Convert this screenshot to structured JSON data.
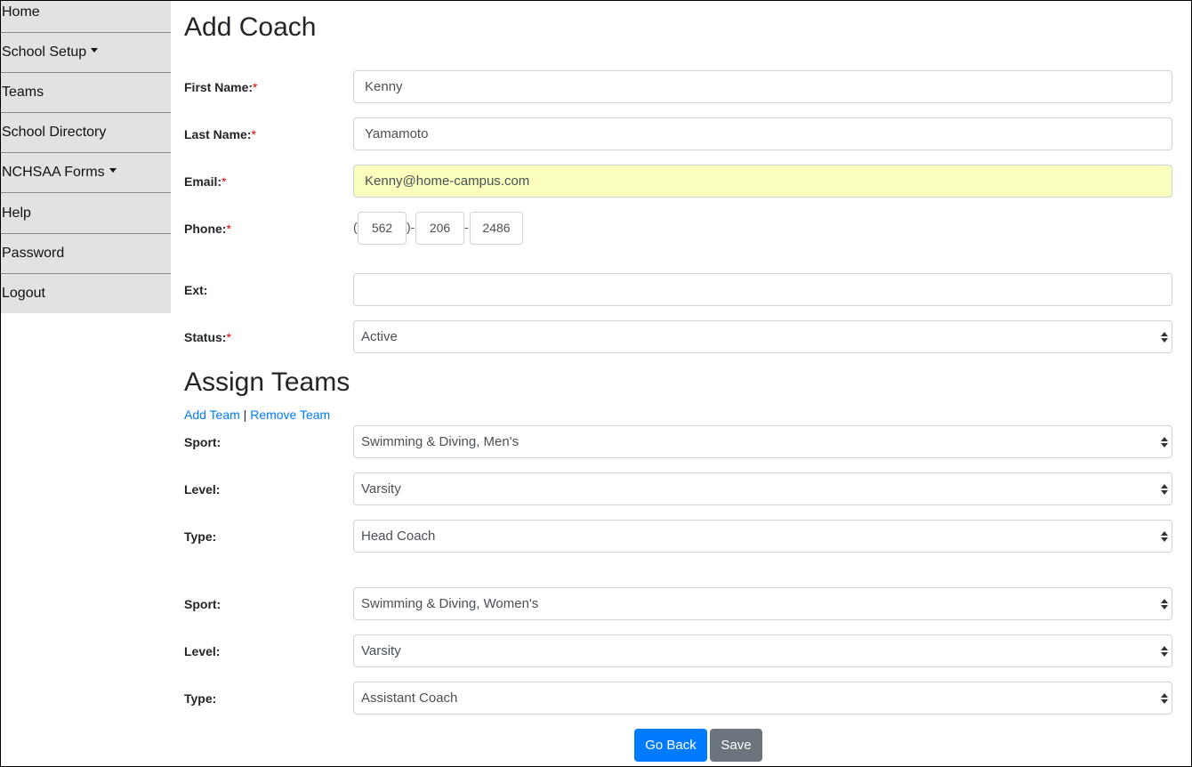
{
  "nav": {
    "items": [
      {
        "label": "Home"
      },
      {
        "label": "School Setup"
      },
      {
        "label": "Teams"
      },
      {
        "label": "School Directory"
      },
      {
        "label": "NCHSAA Forms"
      },
      {
        "label": "Help"
      },
      {
        "label": "Password"
      },
      {
        "label": "Logout"
      }
    ]
  },
  "page": {
    "title": "Add Coach",
    "required_mark": "*"
  },
  "form": {
    "first_name": {
      "label": "First Name:",
      "value": "Kenny"
    },
    "last_name": {
      "label": "Last Name:",
      "value": "Yamamoto"
    },
    "email": {
      "label": "Email:",
      "value": "Kenny@home-campus.com"
    },
    "phone": {
      "label": "Phone:",
      "open": "(",
      "sep1": ")-",
      "sep2": "-",
      "area": "562",
      "prefix": "206",
      "line": "2486"
    },
    "ext": {
      "label": "Ext:",
      "value": ""
    },
    "status": {
      "label": "Status:",
      "value": "Active"
    }
  },
  "assign": {
    "title": "Assign Teams",
    "add_link": "Add Team",
    "divider": "|",
    "remove_link": "Remove Team",
    "teams": [
      {
        "sport_label": "Sport:",
        "sport": "Swimming & Diving, Men's",
        "level_label": "Level:",
        "level": "Varsity",
        "type_label": "Type:",
        "type": "Head Coach"
      },
      {
        "sport_label": "Sport:",
        "sport": "Swimming & Diving, Women's",
        "level_label": "Level:",
        "level": "Varsity",
        "type_label": "Type:",
        "type": "Assistant Coach"
      }
    ]
  },
  "buttons": {
    "go_back": "Go Back",
    "save": "Save"
  }
}
